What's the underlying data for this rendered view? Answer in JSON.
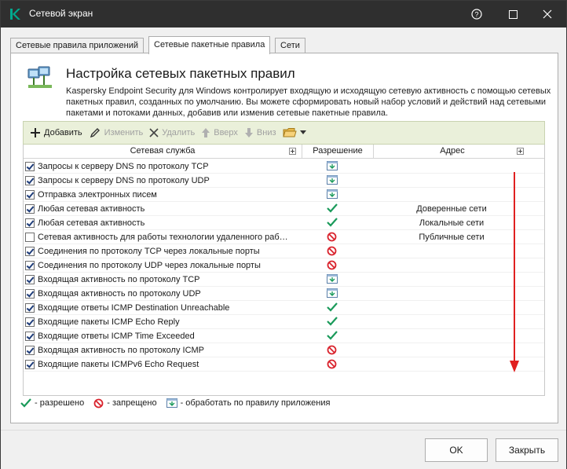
{
  "window": {
    "title": "Сетевой экран",
    "title_buttons": [
      "help-icon",
      "minimize-icon",
      "maximize-icon",
      "close-icon"
    ]
  },
  "tabs": [
    {
      "label": "Сетевые правила приложений",
      "active": false
    },
    {
      "label": "Сетевые пакетные правила",
      "active": true
    },
    {
      "label": "Сети",
      "active": false
    }
  ],
  "header": {
    "title": "Настройка сетевых пакетных правил",
    "description": "Kaspersky Endpoint Security для Windows контролирует входящую и исходящую сетевую активность с помощью сетевых пакетных правил, созданных по умолчанию. Вы можете сформировать новый набор условий и действий над сетевыми пакетами и потоками данных, добавив или изменив сетевые пакетные правила."
  },
  "toolbar": {
    "add": "Добавить",
    "edit": "Изменить",
    "delete": "Удалить",
    "up": "Вверх",
    "down": "Вниз"
  },
  "grid": {
    "columns": {
      "service": "Сетевая служба",
      "permission": "Разрешение",
      "address": "Адрес"
    },
    "rows": [
      {
        "checked": true,
        "service": "Запросы к серверу DNS по протоколу TCP",
        "permission": "app-rule",
        "address": ""
      },
      {
        "checked": true,
        "service": "Запросы к серверу DNS по протоколу UDP",
        "permission": "app-rule",
        "address": ""
      },
      {
        "checked": true,
        "service": "Отправка электронных писем",
        "permission": "app-rule",
        "address": ""
      },
      {
        "checked": true,
        "service": "Любая сетевая активность",
        "permission": "allow",
        "address": "Доверенные сети"
      },
      {
        "checked": true,
        "service": "Любая сетевая активность",
        "permission": "allow",
        "address": "Локальные сети"
      },
      {
        "checked": false,
        "service": "Сетевая активность для работы технологии удаленного раб…",
        "permission": "deny",
        "address": "Публичные сети"
      },
      {
        "checked": true,
        "service": "Соединения по протоколу TCP через локальные порты",
        "permission": "deny",
        "address": ""
      },
      {
        "checked": true,
        "service": "Соединения по протоколу UDP через локальные порты",
        "permission": "deny",
        "address": ""
      },
      {
        "checked": true,
        "service": "Входящая активность по протоколу TCP",
        "permission": "app-rule",
        "address": ""
      },
      {
        "checked": true,
        "service": "Входящая активность по протоколу UDP",
        "permission": "app-rule",
        "address": ""
      },
      {
        "checked": true,
        "service": "Входящие ответы ICMP Destination Unreachable",
        "permission": "allow",
        "address": ""
      },
      {
        "checked": true,
        "service": "Входящие пакеты ICMP Echo Reply",
        "permission": "allow",
        "address": ""
      },
      {
        "checked": true,
        "service": "Входящие ответы ICMP Time Exceeded",
        "permission": "allow",
        "address": ""
      },
      {
        "checked": true,
        "service": "Входящая активность по протоколу ICMP",
        "permission": "deny",
        "address": ""
      },
      {
        "checked": true,
        "service": "Входящие пакеты ICMPv6 Echo Request",
        "permission": "deny",
        "address": ""
      }
    ]
  },
  "legend": {
    "allowed": "- разрешено",
    "denied": "- запрещено",
    "app_rule": "- обработать по правилу приложения"
  },
  "buttons": {
    "ok": "OK",
    "close": "Закрыть"
  },
  "colors": {
    "titlebar": "#2f2f2f",
    "brand": "#00a88e",
    "allow": "#1a9a5a",
    "deny": "#d9232d",
    "toolbar": "#eaf0da",
    "annotation_arrow": "#e02020"
  }
}
